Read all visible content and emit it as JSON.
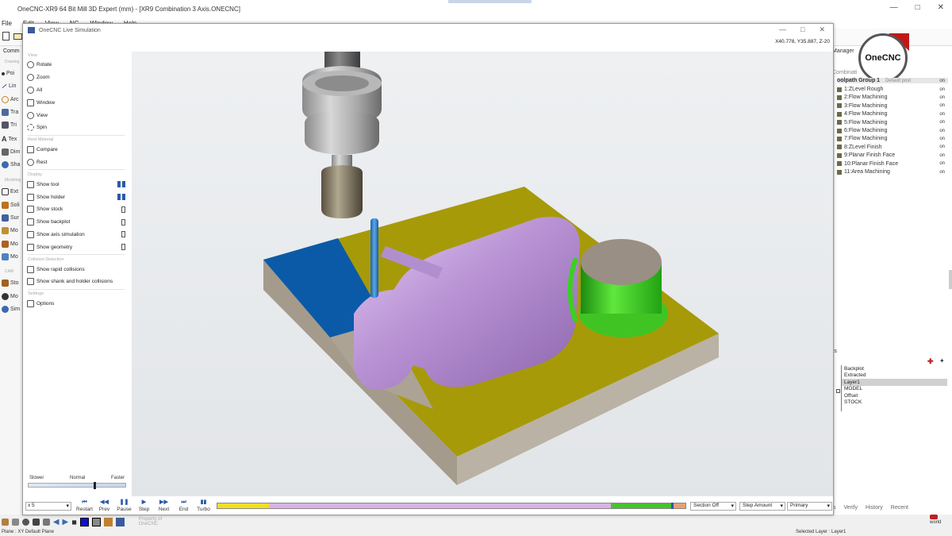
{
  "app": {
    "title": "OneCNC-XR9  64 Bit Mill 3D Expert (mm) - [XR9 Combination 3 Axis.ONECNC]",
    "menu": [
      "File",
      "Edit",
      "View",
      "NC",
      "Window",
      "Help"
    ],
    "left_sections": [
      "Drawing",
      "Modeling",
      "CAM"
    ],
    "left_items": [
      "Poi",
      "Lin",
      "Arc",
      "Tra",
      "Tri",
      "Tex",
      "Dim",
      "Sha",
      "Ext",
      "Soli",
      "Sur",
      "Mo",
      "Mo",
      "Mo",
      "Sto",
      "Mo",
      "Sim"
    ],
    "left_header": "Comm",
    "brand": "OneCNC",
    "property_placeholder": "Property of OneCNC"
  },
  "right_panel": {
    "manager_label": "Manager",
    "combination_label": "Combinati",
    "group_row": "oolpath Group 1",
    "default_post": "Default post",
    "toolpaths": [
      {
        "label": "1:ZLevel Rough",
        "state": "on"
      },
      {
        "label": "2:Flow Machining",
        "state": "on"
      },
      {
        "label": "3:Flow Machining",
        "state": "on"
      },
      {
        "label": "4:Flow Machining",
        "state": "on"
      },
      {
        "label": "5:Flow Machining",
        "state": "on"
      },
      {
        "label": "6:Flow Machining",
        "state": "on"
      },
      {
        "label": "7:Flow Machining",
        "state": "on"
      },
      {
        "label": "8:ZLevel Finish",
        "state": "on"
      },
      {
        "label": "9:Planar Finish Face",
        "state": "on"
      },
      {
        "label": "10:Planar Finish Face",
        "state": "on"
      },
      {
        "label": "11:Area Machining",
        "state": "on"
      }
    ],
    "layers_header": "rs",
    "layers": [
      "Backplot",
      "Extracted",
      "Layer1",
      "MODEL",
      "Offset",
      "STOCK"
    ],
    "selected_layer": "Layer1",
    "bottom_tabs": [
      "s",
      "Verify",
      "History",
      "Recent"
    ],
    "world_label": "world"
  },
  "status": {
    "plane": "Plane : XY Default Plane",
    "selected_layer": "Selected Layer : Layer1"
  },
  "sim": {
    "title": "OneCNC Live Simulation",
    "coords": "X40.778, Y35.887, Z-20",
    "sections": {
      "view": "View",
      "rest": "Rest Material",
      "display": "Display",
      "collision": "Collision Detection",
      "settings": "Settings"
    },
    "view_items": [
      "Rotate",
      "Zoom",
      "All",
      "Window",
      "View",
      "Spin"
    ],
    "rest_items": [
      "Compare",
      "Rest"
    ],
    "display_items": [
      {
        "label": "Show tool",
        "checked": true
      },
      {
        "label": "Show holder",
        "checked": true
      },
      {
        "label": "Show stock",
        "checked": false
      },
      {
        "label": "Show backplot",
        "checked": false
      },
      {
        "label": "Show axis simulation",
        "checked": false
      },
      {
        "label": "Show geometry",
        "checked": false
      }
    ],
    "collision_items": [
      "Show rapid collisions",
      "Show shank and holder collisions"
    ],
    "settings_items": [
      "Options"
    ],
    "speed": {
      "slower": "Slower",
      "normal": "Normal",
      "faster": "Faster",
      "level": 0.68
    },
    "zoom_value": "x 5",
    "transport": [
      {
        "glyph": "⏮",
        "label": "Restart"
      },
      {
        "glyph": "◀◀",
        "label": "Prev"
      },
      {
        "glyph": "❚❚",
        "label": "Pause"
      },
      {
        "glyph": "▶",
        "label": "Step"
      },
      {
        "glyph": "▶▶",
        "label": "Next"
      },
      {
        "glyph": "⏭",
        "label": "End"
      },
      {
        "glyph": "▮▮",
        "label": "Turbo"
      }
    ],
    "progress_segments": [
      {
        "color": "#f0e020",
        "fraction": 0.11
      },
      {
        "color": "#d8b4e6",
        "fraction": 0.73
      },
      {
        "color": "#49c22c",
        "fraction": 0.13
      },
      {
        "color": "#e8a070",
        "fraction": 0.03
      }
    ],
    "section_mode": "Section Off",
    "step_mode": "Step Amount",
    "view_mode": "Primary"
  }
}
